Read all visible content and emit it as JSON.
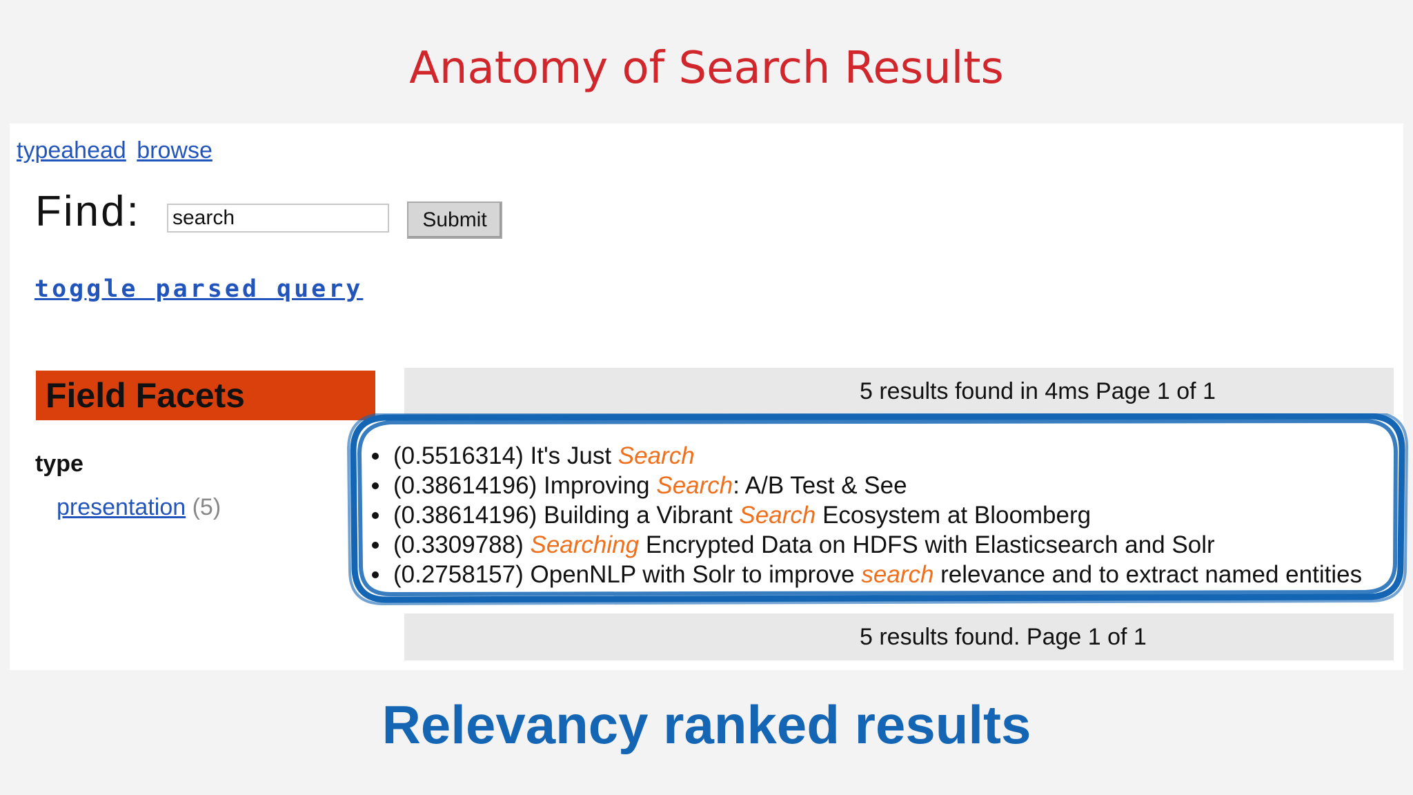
{
  "slide": {
    "title": "Anatomy of Search Results",
    "caption": "Relevancy ranked results"
  },
  "nav": {
    "links": [
      "typeahead",
      "browse"
    ]
  },
  "search": {
    "find_label": "Find:",
    "value": "search",
    "submit_label": "Submit"
  },
  "toggle_label": "toggle parsed query",
  "facets": {
    "header": "Field Facets",
    "field": "type",
    "value_label": "presentation",
    "value_count": "(5)"
  },
  "results": {
    "summary_top": "5 results found in 4ms Page 1 of 1",
    "summary_bottom": "5 results found. Page 1 of 1",
    "highlight_color": "#f06f1b",
    "items": [
      {
        "score": "(0.5516314)",
        "before": "It's Just",
        "highlight": "Search",
        "after": ""
      },
      {
        "score": "(0.38614196)",
        "before": "Improving",
        "highlight": "Search",
        "after": ": A/B Test & See"
      },
      {
        "score": "(0.38614196)",
        "before": "Building a Vibrant",
        "highlight": "Search",
        "after": "Ecosystem at Bloomberg"
      },
      {
        "score": "(0.3309788)",
        "before": "",
        "highlight": "Searching",
        "after": "Encrypted Data on HDFS with Elasticsearch and Solr"
      },
      {
        "score": "(0.2758157)",
        "before": "OpenNLP with Solr to improve",
        "highlight": "search",
        "after": "relevance and to extract named entities"
      }
    ]
  },
  "annotation": {
    "color": "#1466b4"
  }
}
